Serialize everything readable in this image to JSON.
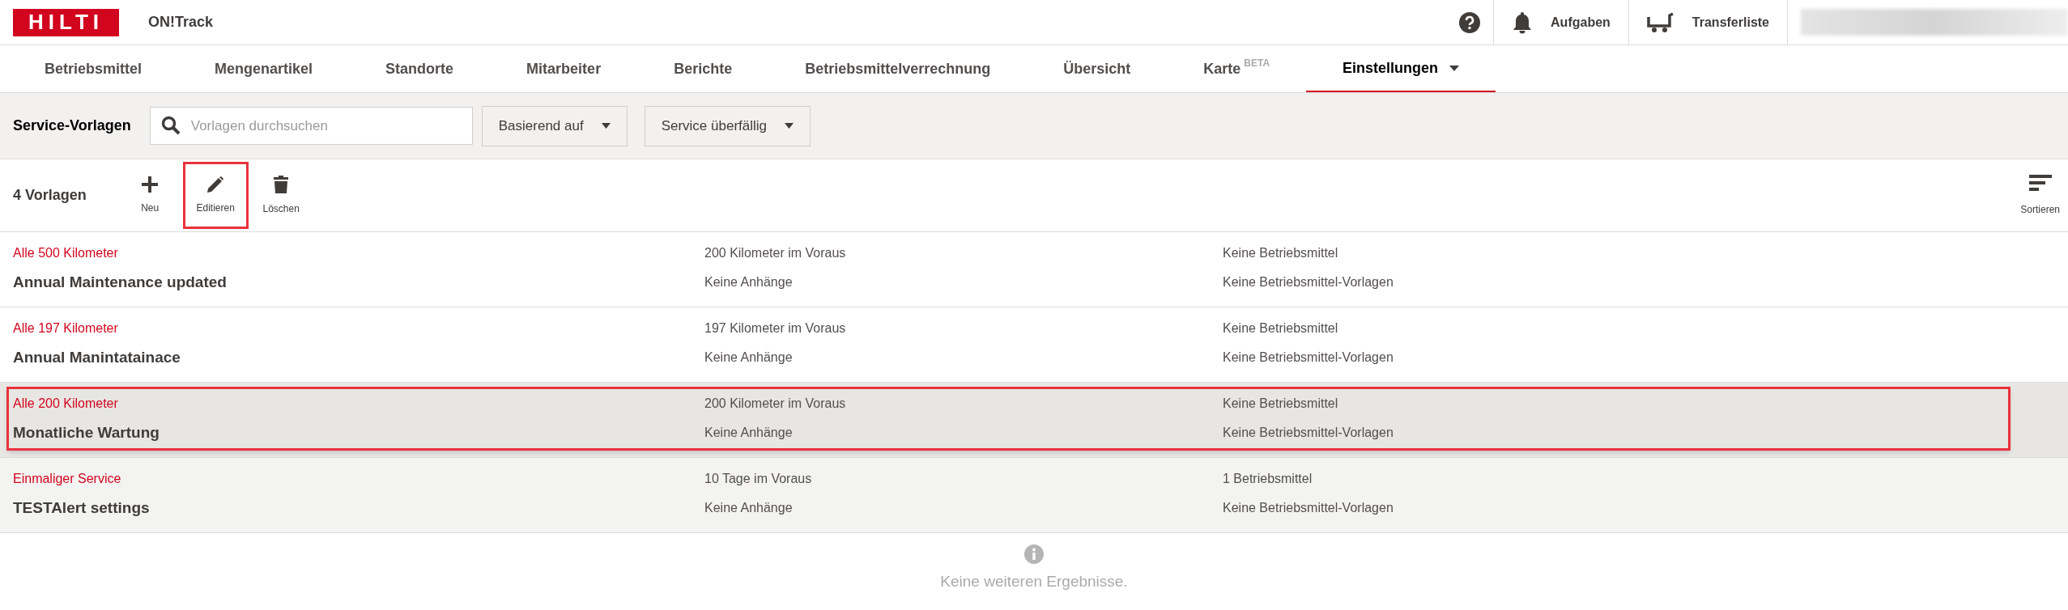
{
  "header": {
    "logo": "HILTI",
    "app_name": "ON!Track",
    "actions": [
      {
        "kind": "bell",
        "label": "Aufgaben"
      },
      {
        "kind": "cart",
        "label": "Transferliste"
      }
    ]
  },
  "nav": [
    {
      "label": "Betriebsmittel",
      "selected": false
    },
    {
      "label": "Mengenartikel",
      "selected": false
    },
    {
      "label": "Standorte",
      "selected": false
    },
    {
      "label": "Mitarbeiter",
      "selected": false
    },
    {
      "label": "Berichte",
      "selected": false
    },
    {
      "label": "Betriebsmittelverrechnung",
      "selected": false
    },
    {
      "label": "Übersicht",
      "selected": false
    },
    {
      "label": "Karte",
      "badge": "BETA",
      "selected": false
    },
    {
      "label": "Einstellungen",
      "dropdown": true,
      "selected": true
    }
  ],
  "filter_bar": {
    "title": "Service-Vorlagen",
    "search": {
      "placeholder": "Vorlagen durchsuchen"
    },
    "dropdowns": [
      "Basierend auf",
      "Service überfällig"
    ]
  },
  "toolbar": {
    "count": "4 Vorlagen",
    "actions": [
      {
        "kind": "add",
        "label": "Neu",
        "highlighted": false
      },
      {
        "kind": "edit",
        "label": "Editieren",
        "highlighted": true
      },
      {
        "kind": "delete",
        "label": "Löschen",
        "highlighted": false
      }
    ],
    "sort": {
      "label": "Sortieren"
    }
  },
  "rows": [
    {
      "interval": "Alle 500 Kilometer",
      "title": "Annual Maintenance updated",
      "advance": "200 Kilometer im Voraus",
      "attachments": "Keine Anhänge",
      "assets": "Keine Betriebsmittel",
      "asset_templates": "Keine Betriebsmittel-Vorlagen",
      "selected": false,
      "hovered": false,
      "highlighted": false
    },
    {
      "interval": "Alle 197 Kilometer",
      "title": "Annual Manintatainace",
      "advance": "197 Kilometer im Voraus",
      "attachments": "Keine Anhänge",
      "assets": "Keine Betriebsmittel",
      "asset_templates": "Keine Betriebsmittel-Vorlagen",
      "selected": false,
      "hovered": false,
      "highlighted": false
    },
    {
      "interval": "Alle 200 Kilometer",
      "title": "Monatliche Wartung",
      "advance": "200 Kilometer im Voraus",
      "attachments": "Keine Anhänge",
      "assets": "Keine Betriebsmittel",
      "asset_templates": "Keine Betriebsmittel-Vorlagen",
      "selected": true,
      "hovered": false,
      "highlighted": true
    },
    {
      "interval": "Einmaliger Service",
      "title": "TESTAlert settings",
      "advance": "10 Tage im Voraus",
      "attachments": "Keine Anhänge",
      "assets": "1 Betriebsmittel",
      "asset_templates": "Keine Betriebsmittel-Vorlagen",
      "selected": false,
      "hovered": true,
      "highlighted": false
    }
  ],
  "footer": {
    "message": "Keine weiteren Ergebnisse."
  }
}
